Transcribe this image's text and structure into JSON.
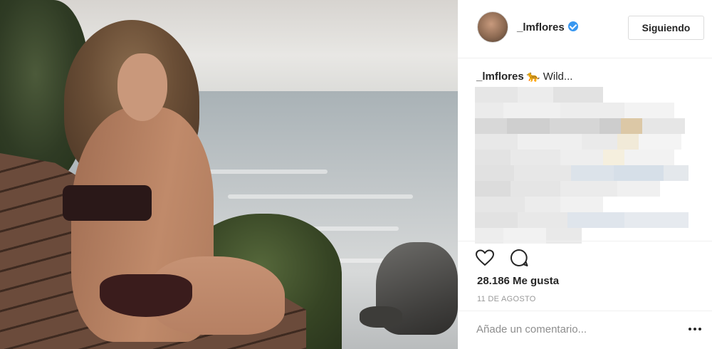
{
  "post": {
    "username": "_lmflores",
    "follow_label": "Siguiendo",
    "caption_user": "_lmflores",
    "caption_emoji": "🐆",
    "caption_text": "Wild...",
    "likes": "28.186 Me gusta",
    "date": "11 DE AGOSTO",
    "comment_placeholder": "Añade un comentario..."
  },
  "colors": {
    "verified": "#3897f0",
    "text": "#262626",
    "muted": "#999999",
    "divider": "#efefef"
  },
  "icons": {
    "like": "heart-outline-icon",
    "comment": "speech-bubble-icon",
    "verified": "verified-badge-icon",
    "more": "ellipsis-icon"
  }
}
